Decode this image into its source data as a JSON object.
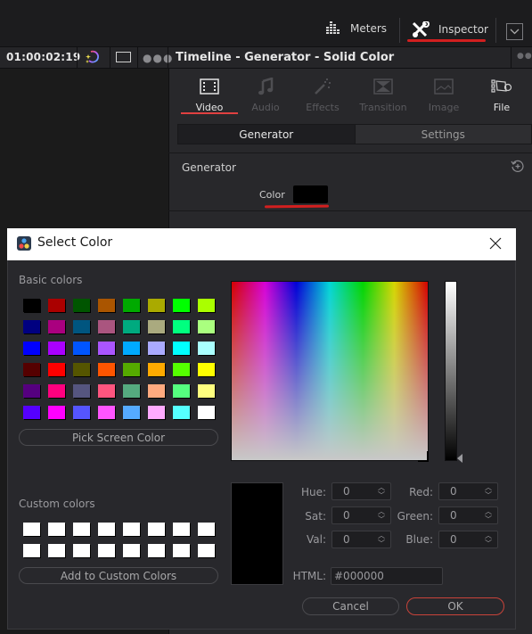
{
  "topbar": {
    "meters_label": "Meters",
    "inspector_label": "Inspector",
    "annotation_color": "#d21f1f"
  },
  "subbar": {
    "timecode": "01:00:02:19",
    "panel_title": "Timeline - Generator - Solid Color"
  },
  "inspector": {
    "tabs": [
      {
        "label": "Video",
        "icon": "film-icon",
        "state": "active"
      },
      {
        "label": "Audio",
        "icon": "music-note-icon",
        "state": "disabled"
      },
      {
        "label": "Effects",
        "icon": "magic-wand-icon",
        "state": "disabled"
      },
      {
        "label": "Transition",
        "icon": "transition-icon",
        "state": "disabled"
      },
      {
        "label": "Image",
        "icon": "image-icon",
        "state": "disabled"
      },
      {
        "label": "File",
        "icon": "camera-icon",
        "state": "normal"
      }
    ],
    "segments": [
      {
        "label": "Generator",
        "selected": true
      },
      {
        "label": "Settings",
        "selected": false
      }
    ],
    "section_title": "Generator",
    "color_label": "Color",
    "color_value": "#000000"
  },
  "dialog": {
    "title": "Select Color",
    "basic_colors_label": "Basic colors",
    "basic_colors": [
      "#000000",
      "#aa0000",
      "#005500",
      "#aa5500",
      "#00aa00",
      "#aaaa00",
      "#00ff00",
      "#aaff00",
      "#000080",
      "#aa007f",
      "#00557f",
      "#aa557f",
      "#00aa7f",
      "#aaaa7f",
      "#00ff7f",
      "#aaff7f",
      "#0000ff",
      "#aa00ff",
      "#0055ff",
      "#aa55ff",
      "#00aaff",
      "#aaaaff",
      "#00ffff",
      "#aaffff",
      "#550000",
      "#ff0000",
      "#555500",
      "#ff5500",
      "#55aa00",
      "#ffaa00",
      "#55ff00",
      "#ffff00",
      "#55007f",
      "#ff007f",
      "#55557f",
      "#ff557f",
      "#55aa7f",
      "#ffaa7f",
      "#55ff7f",
      "#ffff7f",
      "#5500ff",
      "#ff00ff",
      "#5555ff",
      "#ff55ff",
      "#55aaff",
      "#ffaaff",
      "#55ffff",
      "#ffffff"
    ],
    "pick_screen_label": "Pick Screen Color",
    "custom_colors_label": "Custom colors",
    "custom_colors": [
      "#ffffff",
      "#ffffff",
      "#ffffff",
      "#ffffff",
      "#ffffff",
      "#ffffff",
      "#ffffff",
      "#ffffff",
      "#ffffff",
      "#ffffff",
      "#ffffff",
      "#ffffff",
      "#ffffff",
      "#ffffff",
      "#ffffff",
      "#ffffff"
    ],
    "add_custom_label": "Add to Custom Colors",
    "fields": {
      "hue": {
        "label": "Hue:",
        "value": "0"
      },
      "sat": {
        "label": "Sat:",
        "value": "0"
      },
      "val": {
        "label": "Val:",
        "value": "0"
      },
      "red": {
        "label": "Red:",
        "value": "0"
      },
      "green": {
        "label": "Green:",
        "value": "0"
      },
      "blue": {
        "label": "Blue:",
        "value": "0"
      }
    },
    "html_label": "HTML:",
    "html_value": "#000000",
    "cancel_label": "Cancel",
    "ok_label": "OK"
  }
}
